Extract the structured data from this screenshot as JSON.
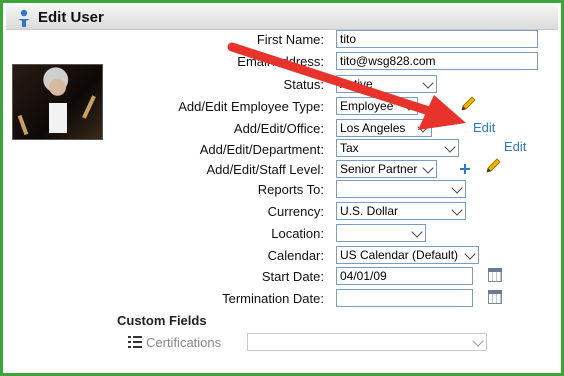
{
  "window": {
    "title": "Edit User"
  },
  "photo": {
    "alt": "User photo"
  },
  "form": {
    "first_name": {
      "label": "First Name:",
      "value": "tito"
    },
    "email": {
      "label": "Email Address:",
      "value": "tito@wsg828.com"
    },
    "status": {
      "label": "Status:",
      "value": "Active"
    },
    "employee_type": {
      "label": "Add/Edit Employee Type:",
      "value": "Employee"
    },
    "office": {
      "label": "Add/Edit/Office:",
      "value": "Los Angeles",
      "edit_link": "Edit"
    },
    "department": {
      "label": "Add/Edit/Department:",
      "value": "Tax",
      "edit_link": "Edit"
    },
    "staff_level": {
      "label": "Add/Edit/Staff Level:",
      "value": "Senior Partner"
    },
    "reports_to": {
      "label": "Reports To:",
      "value": ""
    },
    "currency": {
      "label": "Currency:",
      "value": "U.S. Dollar"
    },
    "location": {
      "label": "Location:",
      "value": ""
    },
    "calendar": {
      "label": "Calendar:",
      "value": "US Calendar (Default)"
    },
    "start_date": {
      "label": "Start Date:",
      "value": "04/01/09"
    },
    "termination_date": {
      "label": "Termination Date:",
      "value": ""
    }
  },
  "custom_fields": {
    "heading": "Custom Fields",
    "certifications": {
      "label": "Certifications",
      "value": ""
    }
  },
  "colors": {
    "frame": "#3aa63a",
    "link": "#2f78c8",
    "arrow": "#e8322c"
  }
}
